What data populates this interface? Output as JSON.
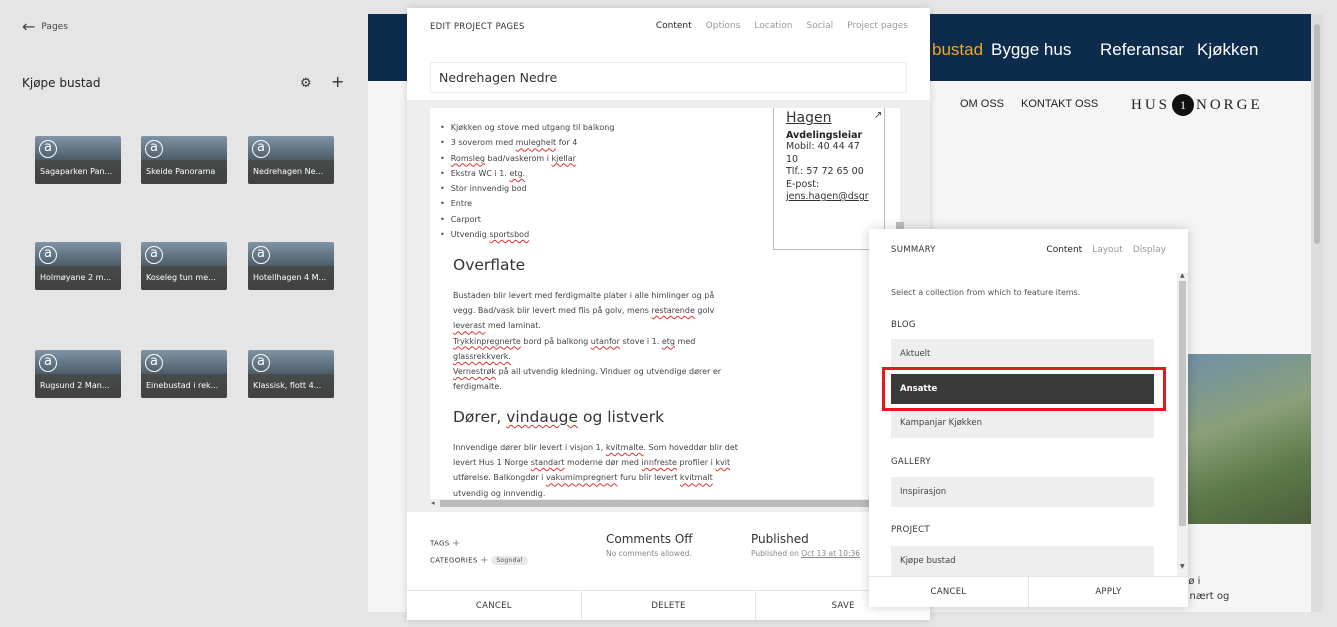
{
  "sidebar": {
    "back_label": "Pages",
    "title": "Kjøpe bustad",
    "items": [
      {
        "label": "Sagaparken Pan..."
      },
      {
        "label": "Skeide Panorama"
      },
      {
        "label": "Nedrehagen Ne..."
      },
      {
        "label": "Holmøyane 2 m..."
      },
      {
        "label": "Koseleg tun me..."
      },
      {
        "label": "Hotellhagen 4 M..."
      },
      {
        "label": "Rugsund 2 Man..."
      },
      {
        "label": "Einebustad i rek..."
      },
      {
        "label": "Klassisk, flott 4..."
      }
    ]
  },
  "site": {
    "nav": [
      "bustad",
      "Bygge hus",
      "Referansar",
      "Kjøkken"
    ],
    "subnav": [
      "OM OSS",
      "KONTAKT OSS"
    ],
    "brand_left": "HUS",
    "brand_num": "1",
    "brand_right": "NORGE",
    "text_lines": [
      "iljø i",
      "g nært og"
    ],
    "colors": {
      "nav_bg": "#0d2b4b",
      "nav_active": "#f5a623"
    }
  },
  "edit": {
    "title": "EDIT PROJECT PAGES",
    "tabs": [
      "Content",
      "Options",
      "Location",
      "Social",
      "Project pages"
    ],
    "page_title": "Nedrehagen Nedre",
    "bullets": [
      "Kjøkken og stove med utgang til balkong",
      "3 soverom med muleghelt for 4",
      "Romsleg bad/vaskerom i kjellar",
      "Ekstra WC i 1. etg.",
      "Stor innvendig bod",
      "Entre",
      "Carport",
      "Utvendig sportsbod"
    ],
    "contact": {
      "name": "Hagen",
      "role": "Avdelingsleiar",
      "mobile": "Mobil: 40 44 47",
      "mobile2": "10",
      "phone": "Tlf.: 57 72 65 00",
      "email_label": "E-post:",
      "email": "jens.hagen@dsgr"
    },
    "section1": {
      "heading": "Overflate",
      "lines": [
        "Bustaden blir levert med ferdigmalte plater i alle himlinger og på",
        "vegg. Bad/vask blir levert med flis på golv, mens restarende golv",
        "leverast med laminat.",
        "Trykkinpregnerte bord på balkong utanfor stove i 1. etg med",
        "glassrekkverk.",
        "Vernestrøk på all utvendig kledning. Vinduer og utvendige dører er",
        "ferdigmalte."
      ]
    },
    "section2": {
      "heading": "Dører, vindauge og listverk",
      "lines": [
        "Innvendige dører blir levert i visjon 1, kvitmalte. Som hoveddør blir det",
        "levert Hus 1 Norge standart moderne dør med innfreste profiler i kvit",
        "utførelse. Balkongdør i vakumimpregnert furu blir levert kvitmalt",
        "utvendig og innvendig."
      ]
    },
    "tags_label": "TAGS",
    "categories_label": "CATEGORIES",
    "category_pill": "Sogndal",
    "comments_title": "Comments Off",
    "comments_sub": "No comments allowed.",
    "published_title": "Published",
    "published_prefix": "Published on",
    "published_date": "Oct 13 at 10:36",
    "buttons": {
      "cancel": "CANCEL",
      "delete": "DELETE",
      "save": "SAVE"
    }
  },
  "summary": {
    "title": "SUMMARY",
    "tabs": [
      "Content",
      "Layout",
      "Display"
    ],
    "description": "Select a collection from which to feature items.",
    "groups": {
      "blog": {
        "label": "BLOG",
        "items": [
          "Aktuelt",
          "Ansatte",
          "Kampanjar Kjøkken"
        ]
      },
      "gallery": {
        "label": "GALLERY",
        "items": [
          "Inspirasjon"
        ]
      },
      "project": {
        "label": "PROJECT",
        "items": [
          "Kjøpe bustad"
        ]
      }
    },
    "selected": "Ansatte",
    "buttons": {
      "cancel": "CANCEL",
      "apply": "APPLY"
    },
    "highlight_color": "#e01a1f"
  }
}
